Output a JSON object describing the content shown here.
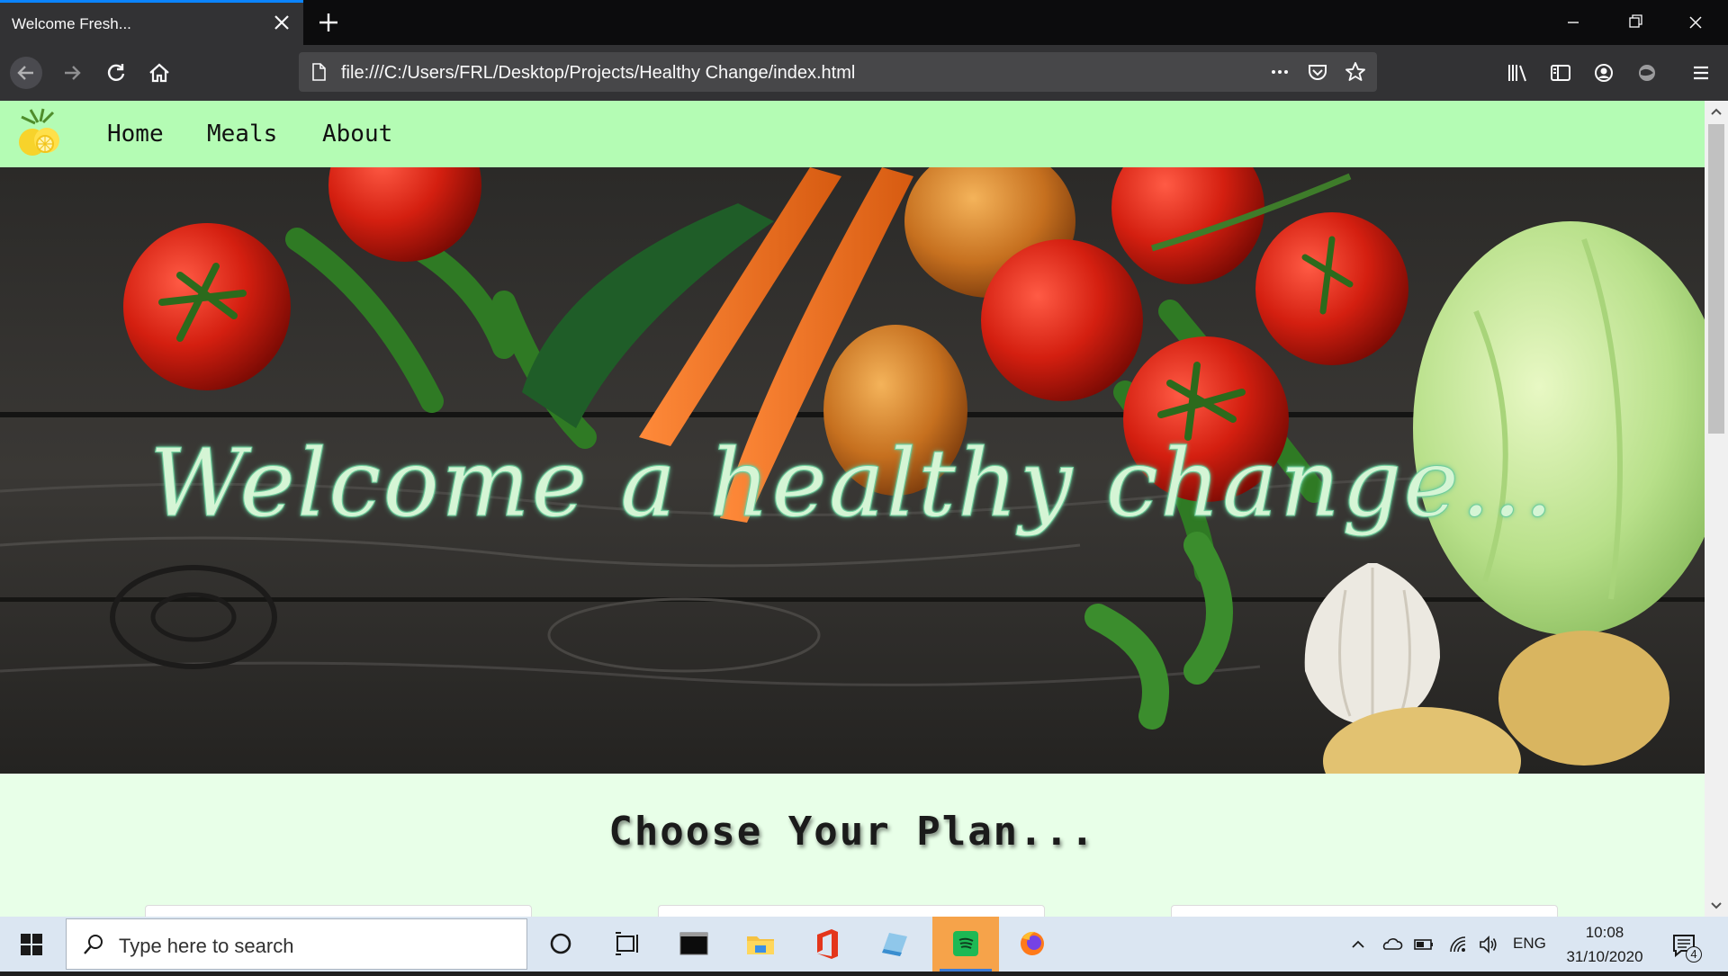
{
  "browser": {
    "tab_title": "Welcome Fresh...",
    "url": "file:///C:/Users/FRL/Desktop/Projects/Healthy Change/index.html"
  },
  "site": {
    "nav": [
      {
        "label": "Home"
      },
      {
        "label": "Meals"
      },
      {
        "label": "About"
      }
    ],
    "hero_title": "Welcome a healthy change...",
    "plan_heading": "Choose Your Plan..."
  },
  "taskbar": {
    "search_placeholder": "Type here to search",
    "language": "ENG",
    "time": "10:08",
    "date": "31/10/2020",
    "notification_count": "4"
  },
  "colors": {
    "site_nav_bg": "#b4fcb4",
    "page_bg": "#e8ffe8",
    "hero_text": "#d5f5d5",
    "firefox_accent": "#0a84ff"
  }
}
